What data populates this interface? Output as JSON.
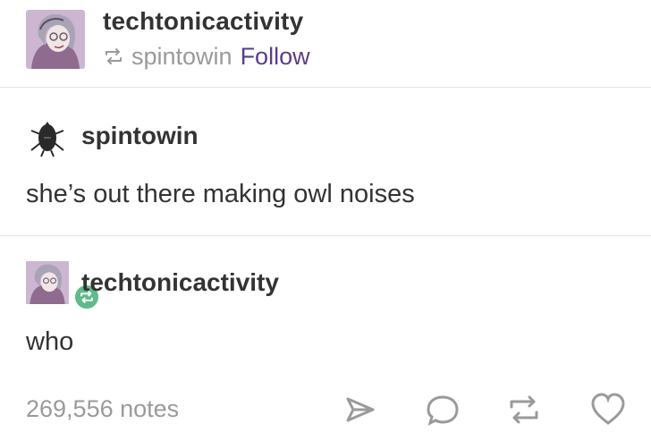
{
  "header": {
    "blog_name": "techtonicactivity",
    "via_name": "spintowin",
    "follow_label": "Follow"
  },
  "trail": [
    {
      "blog_name": "spintowin",
      "text": "she’s out there making owl noises"
    },
    {
      "blog_name": "techtonicactivity",
      "text": "who"
    }
  ],
  "footer": {
    "notes_label": "269,556 notes",
    "actions": [
      "share-icon",
      "reply-icon",
      "reblog-icon",
      "like-icon"
    ]
  },
  "colors": {
    "follow": "#5a3d8a",
    "muted": "#9a9a9a",
    "text": "#333333",
    "reblog_badge": "#5fbb8b",
    "divider": "#e3e3e3"
  }
}
